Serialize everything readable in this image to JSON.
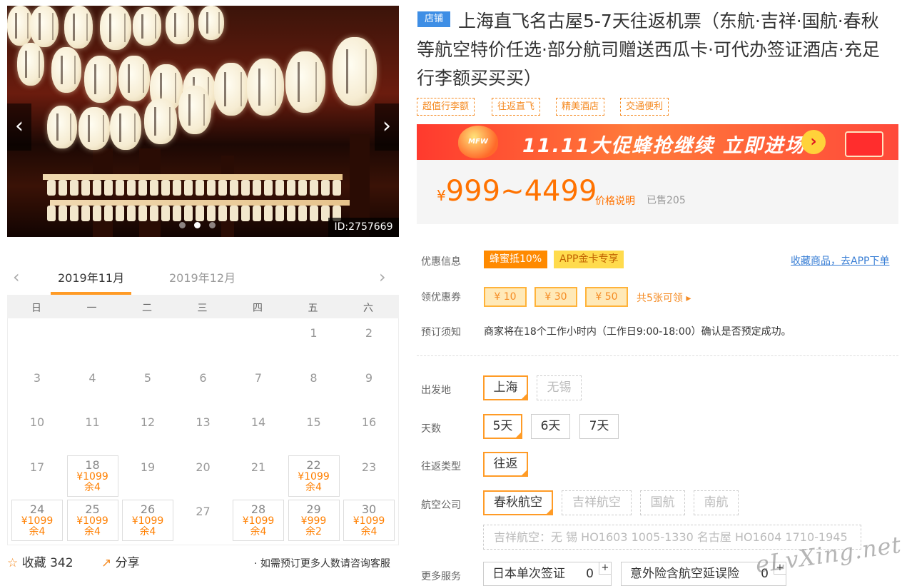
{
  "hero": {
    "image_id": "ID:2757669",
    "lantern_chars": [
      "大",
      "城",
      "家",
      "わ",
      "た",
      "竹",
      "下",
      "百",
      "京とみ",
      "わらべ",
      "あ",
      "村",
      "竹",
      "た",
      "竹",
      "た",
      "か"
    ]
  },
  "calendar": {
    "months": [
      "2019年11月",
      "2019年12月"
    ],
    "active_month": "2019年11月",
    "weekdays": [
      "日",
      "一",
      "二",
      "三",
      "四",
      "五",
      "六"
    ],
    "weeks": [
      [
        {
          "d": ""
        },
        {
          "d": ""
        },
        {
          "d": ""
        },
        {
          "d": ""
        },
        {
          "d": ""
        },
        {
          "d": "1"
        },
        {
          "d": "2"
        }
      ],
      [
        {
          "d": "3"
        },
        {
          "d": "4"
        },
        {
          "d": "5"
        },
        {
          "d": "6"
        },
        {
          "d": "7"
        },
        {
          "d": "8"
        },
        {
          "d": "9"
        }
      ],
      [
        {
          "d": "10"
        },
        {
          "d": "11"
        },
        {
          "d": "12"
        },
        {
          "d": "13"
        },
        {
          "d": "14"
        },
        {
          "d": "15"
        },
        {
          "d": "16"
        }
      ],
      [
        {
          "d": "17"
        },
        {
          "d": "18",
          "p": "¥1099",
          "r": "余4"
        },
        {
          "d": "19"
        },
        {
          "d": "20"
        },
        {
          "d": "21"
        },
        {
          "d": "22",
          "p": "¥1099",
          "r": "余4"
        },
        {
          "d": "23"
        }
      ],
      [
        {
          "d": "24",
          "p": "¥1099",
          "r": "余4"
        },
        {
          "d": "25",
          "p": "¥1099",
          "r": "余4"
        },
        {
          "d": "26",
          "p": "¥1099",
          "r": "余4"
        },
        {
          "d": "27"
        },
        {
          "d": "28",
          "p": "¥1099",
          "r": "余4"
        },
        {
          "d": "29",
          "p": "¥999",
          "r": "余2"
        },
        {
          "d": "30",
          "p": "¥1099",
          "r": "余4"
        }
      ]
    ]
  },
  "footer": {
    "fav_label": "收藏",
    "fav_count": "342",
    "share_label": "分享",
    "note": "· 如需预订更多人数请咨询客服"
  },
  "product": {
    "shop_badge": "店铺",
    "title": "上海直飞名古屋5-7天往返机票（东航·吉祥·国航·春秋等航空特价任选·部分航司赠送西瓜卡·可代办签证酒店·充足行李额买买买）",
    "tags": [
      "超值行李额",
      "往返直飞",
      "精美酒店",
      "交通便利"
    ],
    "promo": {
      "text": "11.11大促蜂抢继续 立即进场",
      "balloon": "MFW"
    },
    "price": {
      "symbol": "¥",
      "range": "999~4499",
      "explain": "价格说明",
      "sold": "已售205"
    }
  },
  "info": {
    "discount_label": "优惠信息",
    "discount_badges": [
      "蜂蜜抵10%",
      "APP金卡专享"
    ],
    "fav_link": "收藏商品，去APP下单",
    "coupon_label": "领优惠券",
    "coupons": [
      "¥ 10",
      "¥ 30",
      "¥ 50"
    ],
    "coupon_more": "共5张可领 ▸",
    "notice_label": "预订须知",
    "notice": "商家将在18个工作小时内（工作日9:00-18:00）确认是否预定成功。"
  },
  "options": {
    "departure_label": "出发地",
    "departure": [
      "上海",
      "无锡"
    ],
    "days_label": "天数",
    "days": [
      "5天",
      "6天",
      "7天"
    ],
    "trip_label": "往返类型",
    "trip": [
      "往返"
    ],
    "airline_label": "航空公司",
    "airlines": [
      "春秋航空",
      "吉祥航空",
      "国航",
      "南航"
    ],
    "flight_info": "吉祥航空：无 锡 HO1603 1005-1330 名古屋 HO1604 1710-1945",
    "more_label": "更多服务",
    "services": [
      {
        "name": "日本单次签证",
        "count": "0",
        "plus": "+"
      },
      {
        "name": "意外险含航空延误险",
        "count": "0",
        "plus": "+"
      }
    ]
  },
  "watermark": "eLvXing.net",
  "colors": {
    "accent": "#ff9b26",
    "price": "#ff7200",
    "link": "#3a7fd5",
    "badge_blue": "#3e8ee5"
  }
}
